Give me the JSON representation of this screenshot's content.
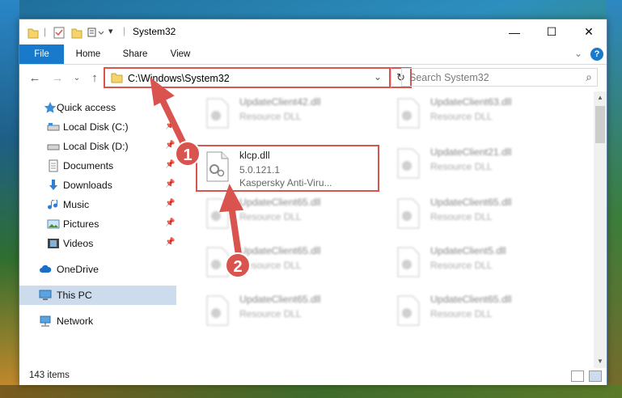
{
  "window": {
    "title": "System32",
    "minimize": "—",
    "maximize": "☐",
    "close": "✕"
  },
  "ribbon": {
    "tabs": [
      {
        "label": "File"
      },
      {
        "label": "Home"
      },
      {
        "label": "Share"
      },
      {
        "label": "View"
      }
    ],
    "help": "?",
    "expand": "⌄"
  },
  "nav": {
    "back": "←",
    "forward": "→",
    "recent": "⌄",
    "up": "↑",
    "address": "C:\\Windows\\System32",
    "address_dropdown": "⌄",
    "refresh": "↻",
    "search_placeholder": "Search System32",
    "search_icon": "⌕"
  },
  "sidebar": {
    "items": [
      {
        "label": "Quick access",
        "icon": "star-icon"
      },
      {
        "label": "Local Disk (C:)",
        "icon": "drive-icon"
      },
      {
        "label": "Local Disk (D:)",
        "icon": "drive-icon"
      },
      {
        "label": "Documents",
        "icon": "documents-icon"
      },
      {
        "label": "Downloads",
        "icon": "downloads-icon"
      },
      {
        "label": "Music",
        "icon": "music-icon"
      },
      {
        "label": "Pictures",
        "icon": "pictures-icon"
      },
      {
        "label": "Videos",
        "icon": "videos-icon"
      },
      {
        "label": "OneDrive",
        "icon": "cloud-icon"
      },
      {
        "label": "This PC",
        "icon": "computer-icon"
      },
      {
        "label": "Network",
        "icon": "network-icon"
      }
    ]
  },
  "files": {
    "left": [
      {
        "name": "UpdateClient42.dll",
        "type": "Resource DLL"
      },
      {
        "name": "klcp.dll",
        "version": "5.0.121.1",
        "company": "Kaspersky Anti-Viru..."
      },
      {
        "name": "UpdateClient65.dll",
        "type": "Resource DLL"
      },
      {
        "name": "UpdateClient65.dll",
        "type": "Resource DLL"
      },
      {
        "name": "UpdateClient65.dll",
        "type": "Resource DLL"
      }
    ],
    "right": [
      {
        "name": "UpdateClient63.dll",
        "type": "Resource DLL"
      },
      {
        "name": "UpdateClient21.dll",
        "type": "Resource DLL"
      },
      {
        "name": "UpdateClient65.dll",
        "type": "Resource DLL"
      },
      {
        "name": "UpdateClient5.dll",
        "type": "Resource DLL"
      },
      {
        "name": "UpdateClient65.dll",
        "type": "Resource DLL"
      }
    ]
  },
  "status": {
    "count": "143 items"
  },
  "annotations": {
    "marker1": "1",
    "marker2": "2"
  },
  "colors": {
    "highlight": "#d9534f",
    "file_tab": "#1979ca",
    "selected": "#ccdcec"
  }
}
